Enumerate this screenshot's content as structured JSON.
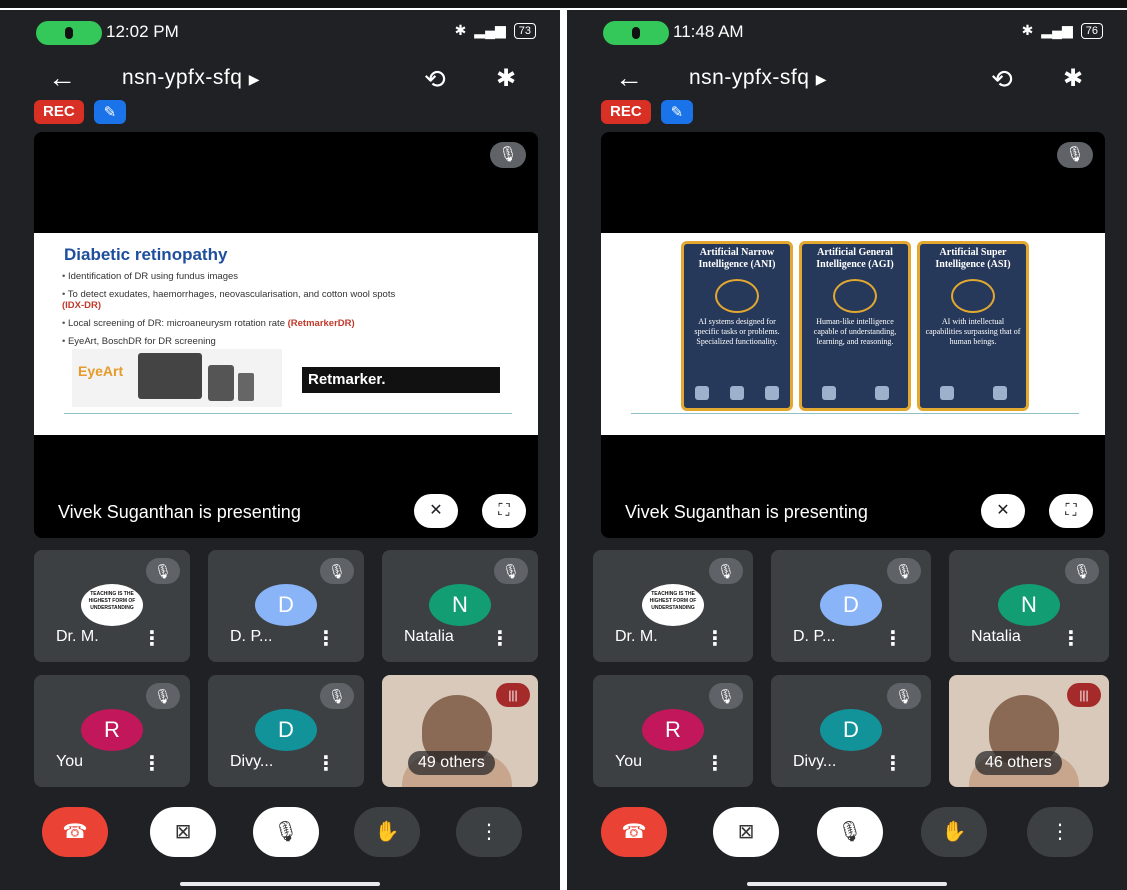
{
  "left": {
    "time": "12:02 PM",
    "battery": "73",
    "meeting_code": "nsn-ypfx-sfq",
    "rec_label": "REC",
    "presenting_text": "Vivek Suganthan is presenting",
    "slide": {
      "title": "Diabetic retinopathy",
      "bullets": [
        "Identification of DR using fundus images",
        "To detect exudates, haemorrhages, neovascularisation, and cotton wool spots",
        "Local screening of DR: microaneurysm rotation rate",
        "EyeArt, BoschDR for DR screening"
      ],
      "bullet2_highlight": "(IDX-DR)",
      "bullet3_highlight": "(RetmarkerDR)",
      "eyeart_label": "EyeArt",
      "retmarker_label": "Retmarker."
    },
    "tiles": [
      {
        "name": "Dr. M.",
        "avatar_text": "TEACHING IS THE HIGHEST FORM OF UNDERSTANDING"
      },
      {
        "name": "D. P...",
        "initial": "D",
        "color": "#8ab4f8"
      },
      {
        "name": "Natalia",
        "initial": "N",
        "color": "#129e72"
      },
      {
        "name": "You",
        "initial": "R",
        "color": "#c2185b"
      },
      {
        "name": "Divy...",
        "initial": "D",
        "color": "#12939a"
      },
      {
        "others": "49 others"
      }
    ]
  },
  "right": {
    "time": "11:48 AM",
    "battery": "76",
    "meeting_code": "nsn-ypfx-sfq",
    "rec_label": "REC",
    "presenting_text": "Vivek Suganthan is presenting",
    "slide": {
      "cards": [
        {
          "title": "Artificial Narrow Intelligence (ANI)",
          "desc": "AI systems designed for specific tasks or problems. Specialized functionality."
        },
        {
          "title": "Artificial General Intelligence (AGI)",
          "desc": "Human-like intelligence capable of understanding, learning, and reasoning."
        },
        {
          "title": "Artificial Super Intelligence (ASI)",
          "desc": "AI with intellectual capabilities surpassing that of human beings."
        }
      ]
    },
    "tiles": [
      {
        "name": "Dr. M.",
        "avatar_text": "TEACHING IS THE HIGHEST FORM OF UNDERSTANDING"
      },
      {
        "name": "D. P...",
        "initial": "D",
        "color": "#8ab4f8"
      },
      {
        "name": "Natalia",
        "initial": "N",
        "color": "#129e72"
      },
      {
        "name": "You",
        "initial": "R",
        "color": "#c2185b"
      },
      {
        "name": "Divy...",
        "initial": "D",
        "color": "#12939a"
      },
      {
        "others": "46 others"
      }
    ]
  },
  "icons": {
    "back": "arrow-left-icon",
    "switch_camera": "switch-camera-icon",
    "bluetooth": "bluetooth-icon",
    "mic_off": "mic-off-icon",
    "camera_off": "camera-off-icon",
    "hand": "raise-hand-icon",
    "more": "more-vert-icon",
    "end_call": "end-call-icon"
  }
}
